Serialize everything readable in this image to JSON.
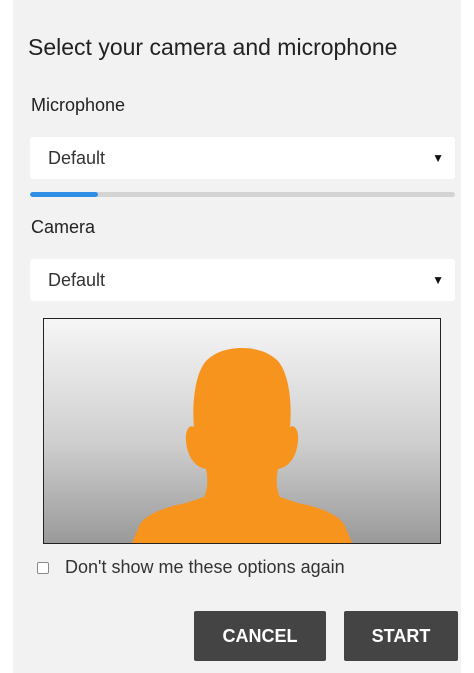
{
  "dialog": {
    "title": "Select your camera and microphone"
  },
  "microphone": {
    "label": "Microphone",
    "selected": "Default",
    "input_level": 0.16
  },
  "camera": {
    "label": "Camera",
    "selected": "Default"
  },
  "preview": {
    "avatar_icon": "person-silhouette-icon",
    "avatar_color": "#f7941d"
  },
  "options": {
    "dont_show_label": "Don't show me these options again",
    "dont_show_checked": false
  },
  "buttons": {
    "cancel_label": "CANCEL",
    "start_label": "START"
  },
  "colors": {
    "accent": "#2f8fe6",
    "button_bg": "#444444",
    "dialog_bg": "#f2f2f2"
  },
  "icons": {
    "dropdown": "caret-down-icon"
  }
}
